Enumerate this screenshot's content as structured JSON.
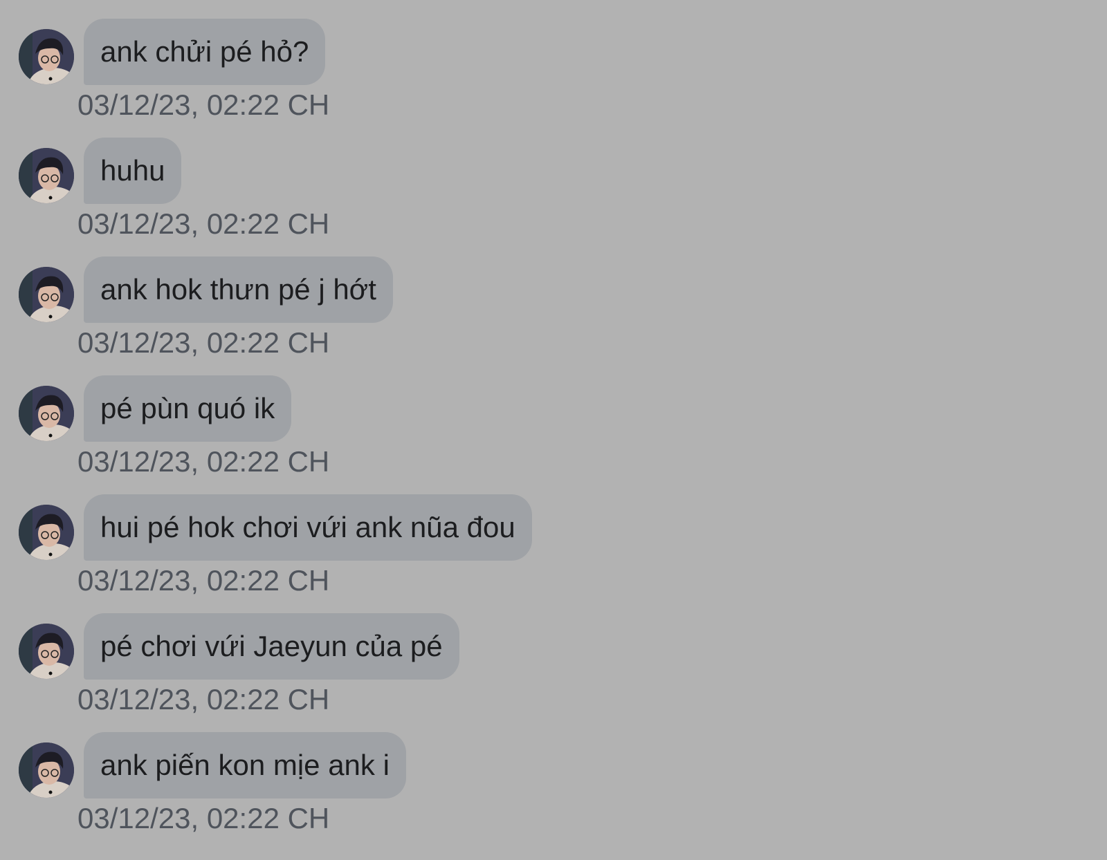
{
  "messages": [
    {
      "text": "ank chửi pé hỏ?",
      "time": "03/12/23, 02:22 CH"
    },
    {
      "text": "huhu",
      "time": "03/12/23, 02:22 CH"
    },
    {
      "text": "ank hok thưn pé j hớt",
      "time": "03/12/23, 02:22 CH"
    },
    {
      "text": "pé pùn quó ik",
      "time": "03/12/23, 02:22 CH"
    },
    {
      "text": "hui pé hok chơi vứi ank nũa đou",
      "time": "03/12/23, 02:22 CH"
    },
    {
      "text": "pé chơi vứi Jaeyun của pé",
      "time": "03/12/23, 02:22 CH"
    },
    {
      "text": "ank piến kon mịe ank i",
      "time": "03/12/23, 02:22 CH"
    }
  ],
  "colors": {
    "background": "#b2b2b2",
    "bubble": "#9fa2a6",
    "message_text": "#1c1d1f",
    "timestamp_text": "#4f545c"
  },
  "icons": {
    "avatar": "avatar-photo"
  }
}
